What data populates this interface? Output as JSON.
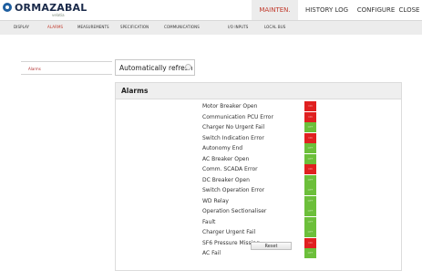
{
  "logo": {
    "name": "ORMAZABAL",
    "sub": "velatia"
  },
  "topnav": [
    {
      "label": "MAINTEN.",
      "active": true
    },
    {
      "label": "HISTORY LOG",
      "active": false
    },
    {
      "label": "CONFIGURE",
      "active": false
    },
    {
      "label": "CLOSE",
      "active": false
    }
  ],
  "subnav": [
    {
      "label": "DISPLAY",
      "active": false
    },
    {
      "label": "ALARMS",
      "active": true
    },
    {
      "label": "MEASUREMENTS",
      "active": false
    },
    {
      "label": "SPECIFICATION",
      "active": false
    },
    {
      "label": "COMMUNICATIONS",
      "active": false
    },
    {
      "label": "I/O INPUTS",
      "active": false
    },
    {
      "label": "LOCAL BUS",
      "active": false
    }
  ],
  "sidebar": {
    "item": "Alarms"
  },
  "auto_refresh": {
    "label": "Automatically refresh",
    "checked": false
  },
  "alarms": {
    "title": "Alarms",
    "status_on_label": "ON",
    "status_off_label": "OFF",
    "colors": {
      "on": "#e02020",
      "off": "#6cbf3a"
    },
    "rows": [
      {
        "label": "Motor Breaker Open",
        "active": true
      },
      {
        "label": "Communication PCU Error",
        "active": true
      },
      {
        "label": "Charger No Urgent Fail",
        "active": false
      },
      {
        "label": "Switch Indication Error",
        "active": true
      },
      {
        "label": "Autonomy End",
        "active": false
      },
      {
        "label": "AC Breaker Open",
        "active": false
      },
      {
        "label": "Comm. SCADA Error",
        "active": true
      },
      {
        "label": "DC Breaker Open",
        "active": false
      },
      {
        "label": "Switch Operation Error",
        "active": false
      },
      {
        "label": "WD Relay",
        "active": false
      },
      {
        "label": "Operation Sectionaliser",
        "active": false
      },
      {
        "label": "Fault",
        "active": false
      },
      {
        "label": "Charger Urgent Fail",
        "active": false
      },
      {
        "label": "SF6 Pressure Missing",
        "active": true
      },
      {
        "label": "AC Fail",
        "active": false
      }
    ],
    "reset_label": "Reset"
  }
}
